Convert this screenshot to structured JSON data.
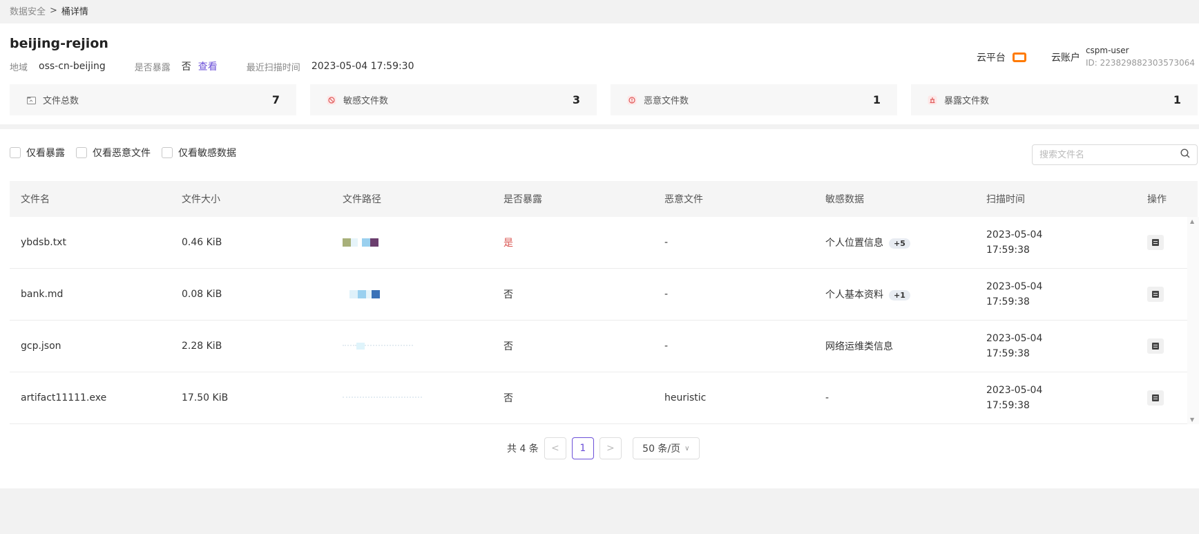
{
  "breadcrumb": {
    "parent": "数据安全",
    "separator": ">",
    "current": "桶详情"
  },
  "bucket": {
    "name": "beijing-rejion",
    "region_label": "地域",
    "region_value": "oss-cn-beijing",
    "exposed_label": "是否暴露",
    "exposed_value": "否",
    "view_link": "查看",
    "scan_time_label": "最近扫描时间",
    "scan_time_value": "2023-05-04 17:59:30"
  },
  "cloud": {
    "platform_label": "云平台",
    "platform_icon": "alibaba-cloud-icon",
    "account_label": "云账户",
    "account_user": "cspm-user",
    "account_id": "ID: 223829882303573064"
  },
  "stats": [
    {
      "label": "文件总数",
      "value": "7",
      "icon": "folder-icon",
      "color": "#888888"
    },
    {
      "label": "敏感文件数",
      "value": "3",
      "icon": "sensitive-icon",
      "color": "#e05a5a"
    },
    {
      "label": "恶意文件数",
      "value": "1",
      "icon": "malicious-icon",
      "color": "#e05a5a"
    },
    {
      "label": "暴露文件数",
      "value": "1",
      "icon": "exposed-icon",
      "color": "#e05a5a"
    }
  ],
  "filters": {
    "only_exposed": "仅看暴露",
    "only_malicious": "仅看恶意文件",
    "only_sensitive": "仅看敏感数据"
  },
  "search": {
    "placeholder": "搜索文件名",
    "value": ""
  },
  "table": {
    "headers": [
      "文件名",
      "文件大小",
      "文件路径",
      "是否暴露",
      "恶意文件",
      "敏感数据",
      "扫描时间",
      "操作"
    ],
    "rows": [
      {
        "name": "ybdsb.txt",
        "size": "0.46 KiB",
        "exposed": "是",
        "malicious": "-",
        "sensitive": "个人位置信息",
        "sensitive_extra": "+5",
        "date": "2023-05-04",
        "time": "17:59:38"
      },
      {
        "name": "bank.md",
        "size": "0.08 KiB",
        "exposed": "否",
        "malicious": "-",
        "sensitive": "个人基本资料",
        "sensitive_extra": "+1",
        "date": "2023-05-04",
        "time": "17:59:38"
      },
      {
        "name": "gcp.json",
        "size": "2.28 KiB",
        "exposed": "否",
        "malicious": "-",
        "sensitive": "网络运维类信息",
        "sensitive_extra": "",
        "date": "2023-05-04",
        "time": "17:59:38"
      },
      {
        "name": "artifact11111.exe",
        "size": "17.50 KiB",
        "exposed": "否",
        "malicious": "heuristic",
        "sensitive": "-",
        "sensitive_extra": "",
        "date": "2023-05-04",
        "time": "17:59:38"
      }
    ]
  },
  "pagination": {
    "total": "共 4 条",
    "prev": "<",
    "current": "1",
    "next": ">",
    "page_size": "50 条/页"
  },
  "colors": {
    "accent": "#6b4fd8",
    "danger": "#d9534f",
    "cloud_orange": "#ff7a00"
  }
}
